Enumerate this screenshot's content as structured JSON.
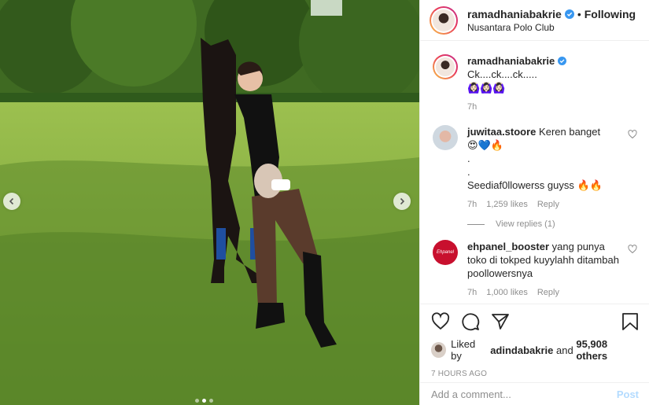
{
  "post": {
    "author": "ramadhaniabakrie",
    "follow_status": "Following",
    "separator": "•",
    "location": "Nusantara Polo Club"
  },
  "caption": {
    "user": "ramadhaniabakrie",
    "text": "Ck....ck....ck.....",
    "emoji": "🙆🏻‍♀️🙆🏻‍♀️🙆🏻‍♀️",
    "time": "7h"
  },
  "comments": [
    {
      "user": "juwitaa.stoore",
      "text": "Keren banget",
      "line2": "😍💙🔥",
      "line3": ".",
      "line4": ".",
      "line5": "Seediaf0llowerss guyss 🔥🔥",
      "time": "7h",
      "likes": "1,259 likes",
      "reply": "Reply",
      "view_replies": "View replies (1)"
    },
    {
      "user": "ehpanel_booster",
      "text": "yang punya toko di tokped kuyylahh ditambah poollowersnya",
      "avatar_text": "Ehpanel",
      "time": "7h",
      "likes": "1,000 likes",
      "reply": "Reply"
    }
  ],
  "likes_summary": {
    "prefix": "Liked by",
    "user": "adindabakrie",
    "middle": "and",
    "count": "95,908 others"
  },
  "time_ago": "7 HOURS AGO",
  "add_comment": {
    "placeholder": "Add a comment...",
    "post_label": "Post"
  },
  "icons": {
    "verified": "verified-badge-icon",
    "heart": "heart-icon",
    "comment": "comment-icon",
    "share": "share-icon",
    "bookmark": "bookmark-icon",
    "prev": "chevron-left-icon",
    "next": "chevron-right-icon"
  },
  "colors": {
    "verified_blue": "#3897f0",
    "muted_text": "#8e8e8e",
    "post_button": "#b3dbff",
    "ehpanel_red": "#c8102e"
  }
}
